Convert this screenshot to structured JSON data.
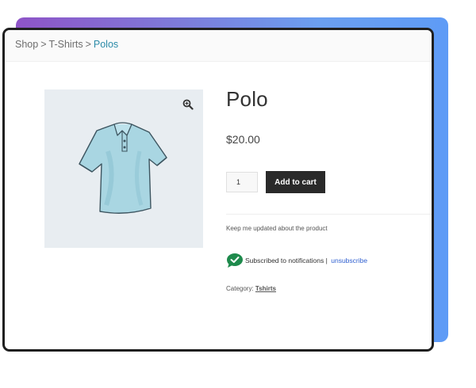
{
  "breadcrumb": {
    "items": [
      {
        "label": "Shop"
      },
      {
        "label": "T-Shirts"
      },
      {
        "label": "Polos"
      }
    ],
    "separator": ">"
  },
  "product": {
    "title": "Polo",
    "price": "$20.00",
    "image_icon": "zoom-in-icon",
    "image_subject": "light-blue polo shirt"
  },
  "cart": {
    "quantity": "1",
    "add_label": "Add to cart"
  },
  "notifications": {
    "prompt": "Keep me updated about the product",
    "status_text": "Subscribed to notifications |",
    "unsubscribe_label": "unsubscribe",
    "status_icon": "chat-check-icon"
  },
  "meta": {
    "category_label": "Category:",
    "category_value": "Tshirts"
  },
  "colors": {
    "accent": "#2b8ba8",
    "button_bg": "#2a2a2a",
    "link": "#3060d0",
    "check_icon": "#1e8a4c",
    "image_bg": "#e8edf1"
  }
}
